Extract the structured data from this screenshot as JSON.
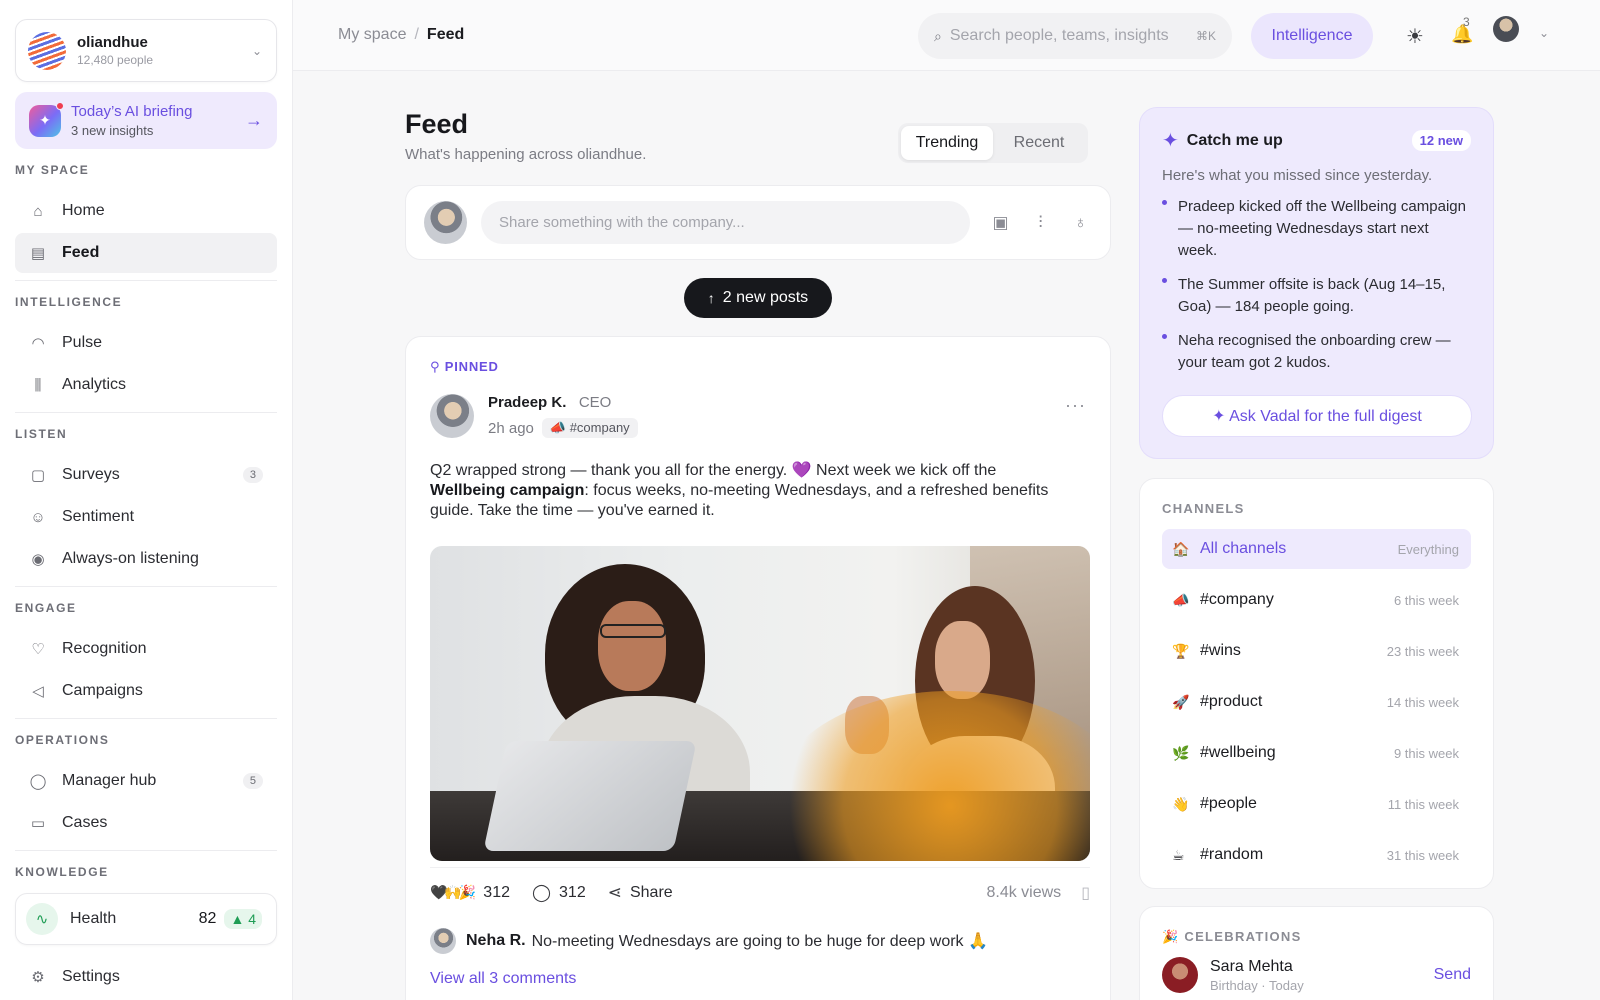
{
  "sidebar": {
    "org": {
      "name": "oliandhue",
      "people": "12,480 people"
    },
    "briefing": {
      "title": "Today’s AI briefing",
      "subtitle": "3 new insights"
    },
    "sections": [
      {
        "label": "MY SPACE",
        "items": [
          {
            "label": "Home",
            "icon": "home-icon",
            "glyph": "⌂"
          },
          {
            "label": "Feed",
            "icon": "feed-icon",
            "glyph": "▤",
            "active": true
          }
        ]
      },
      {
        "label": "INTELLIGENCE",
        "items": [
          {
            "label": "Pulse",
            "icon": "gauge-icon",
            "glyph": "◠"
          },
          {
            "label": "Analytics",
            "icon": "bar-chart-icon",
            "glyph": "⫼"
          }
        ]
      },
      {
        "label": "LISTEN",
        "items": [
          {
            "label": "Surveys",
            "icon": "clipboard-icon",
            "glyph": "▢",
            "count": "3"
          },
          {
            "label": "Sentiment",
            "icon": "smile-icon",
            "glyph": "☺"
          },
          {
            "label": "Always-on listening",
            "icon": "broadcast-icon",
            "glyph": "◉"
          }
        ]
      },
      {
        "label": "ENGAGE",
        "items": [
          {
            "label": "Recognition",
            "icon": "heart-hand-icon",
            "glyph": "♡"
          },
          {
            "label": "Campaigns",
            "icon": "megaphone-icon",
            "glyph": "◁"
          }
        ]
      },
      {
        "label": "OPERATIONS",
        "items": [
          {
            "label": "Manager hub",
            "icon": "user-icon",
            "glyph": "◯",
            "count": "5"
          },
          {
            "label": "Cases",
            "icon": "folder-icon",
            "glyph": "▭"
          }
        ]
      }
    ],
    "knowledge": {
      "label": "KNOWLEDGE",
      "health": {
        "label": "Health",
        "score": "82",
        "delta": "▲ 4"
      }
    },
    "settings": "Settings"
  },
  "topbar": {
    "breadcrumb": [
      "My space",
      "Feed"
    ],
    "search_placeholder": "Search people, teams, insights",
    "search_shortcut": "⌘K",
    "intelligence": "Intelligence",
    "notifications": "3"
  },
  "feed": {
    "title": "Feed",
    "subtitle": "What's happening across oliandhue.",
    "tabs": [
      "Trending",
      "Recent"
    ],
    "composer_placeholder": "Share something with the company...",
    "new_posts": "2 new posts",
    "post": {
      "pinned": "PINNED",
      "author": "Pradeep K.",
      "role": "CEO",
      "time": "2h ago",
      "tag": "#company",
      "body_part1": "Q2 wrapped strong — thank you all for the energy. 💜 Next week we kick off the ",
      "body_bold": "Wellbeing campaign",
      "body_part2": ": focus weeks, no-meeting Wednesdays, and a refreshed benefits guide. Take the time — you've earned it.",
      "reactions": "312",
      "comments": "312",
      "share": "Share",
      "views": "8.4k views",
      "comment_author": "Neha R.",
      "comment_text": "No-meeting Wednesdays are going to be huge for deep work 🙏",
      "view_all": "View all 3 comments"
    }
  },
  "catchup": {
    "title": "Catch me up",
    "badge": "12 new",
    "subtitle": "Here's what you missed since yesterday.",
    "items": [
      "Pradeep kicked off the Wellbeing campaign — no-meeting Wednesdays start next week.",
      "The Summer offsite is back (Aug 14–15, Goa) — 184 people going.",
      "Neha recognised the onboarding crew — your team got 2 kudos."
    ],
    "cta": "Ask Vadal for the full digest"
  },
  "channels": {
    "label": "CHANNELS",
    "items": [
      {
        "emoji": "🏠",
        "name": "All channels",
        "meta": "Everything",
        "active": true
      },
      {
        "emoji": "📣",
        "name": "#company",
        "meta": "6 this week"
      },
      {
        "emoji": "🏆",
        "name": "#wins",
        "meta": "23 this week"
      },
      {
        "emoji": "🚀",
        "name": "#product",
        "meta": "14 this week"
      },
      {
        "emoji": "🌿",
        "name": "#wellbeing",
        "meta": "9 this week"
      },
      {
        "emoji": "👋",
        "name": "#people",
        "meta": "11 this week"
      },
      {
        "emoji": "☕",
        "name": "#random",
        "meta": "31 this week"
      }
    ]
  },
  "celebrations": {
    "label": "🎉 CELEBRATIONS",
    "person": {
      "name": "Sara Mehta",
      "detail": "Birthday · Today",
      "action": "Send"
    }
  }
}
